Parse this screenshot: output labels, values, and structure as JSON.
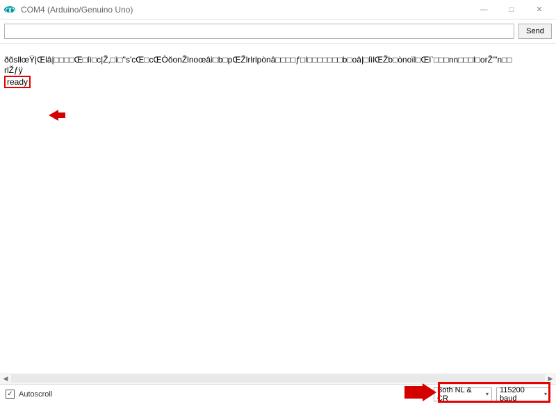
{
  "window": {
    "title": "COM4 (Arduino/Genuino Uno)",
    "min_label": "—",
    "max_label": "□",
    "close_label": "✕"
  },
  "input": {
    "value": "",
    "send_label": "Send"
  },
  "console": {
    "line1": "ðõsllœŸ|Œlâ|□□□□Œ□lì□c|Ž,□ì□\"s'cŒ□cŒÒŏonŽlnoœâì□b□pŒŽlrlrlpònâ□□□□ƒ□l□□□□□□□b□oâ|□lìlŒŽb□ònoïl□Œl`□□□nn□□□l□orŽ\"'n□□",
    "line2": "rlŽƒÿ",
    "ready_label": "ready"
  },
  "scrollbar": {
    "left": "◀",
    "right": "▶"
  },
  "footer": {
    "autoscroll_label": "Autoscroll",
    "autoscroll_checked": true,
    "line_ending": "Both NL & CR",
    "baud": "115200 baud"
  }
}
